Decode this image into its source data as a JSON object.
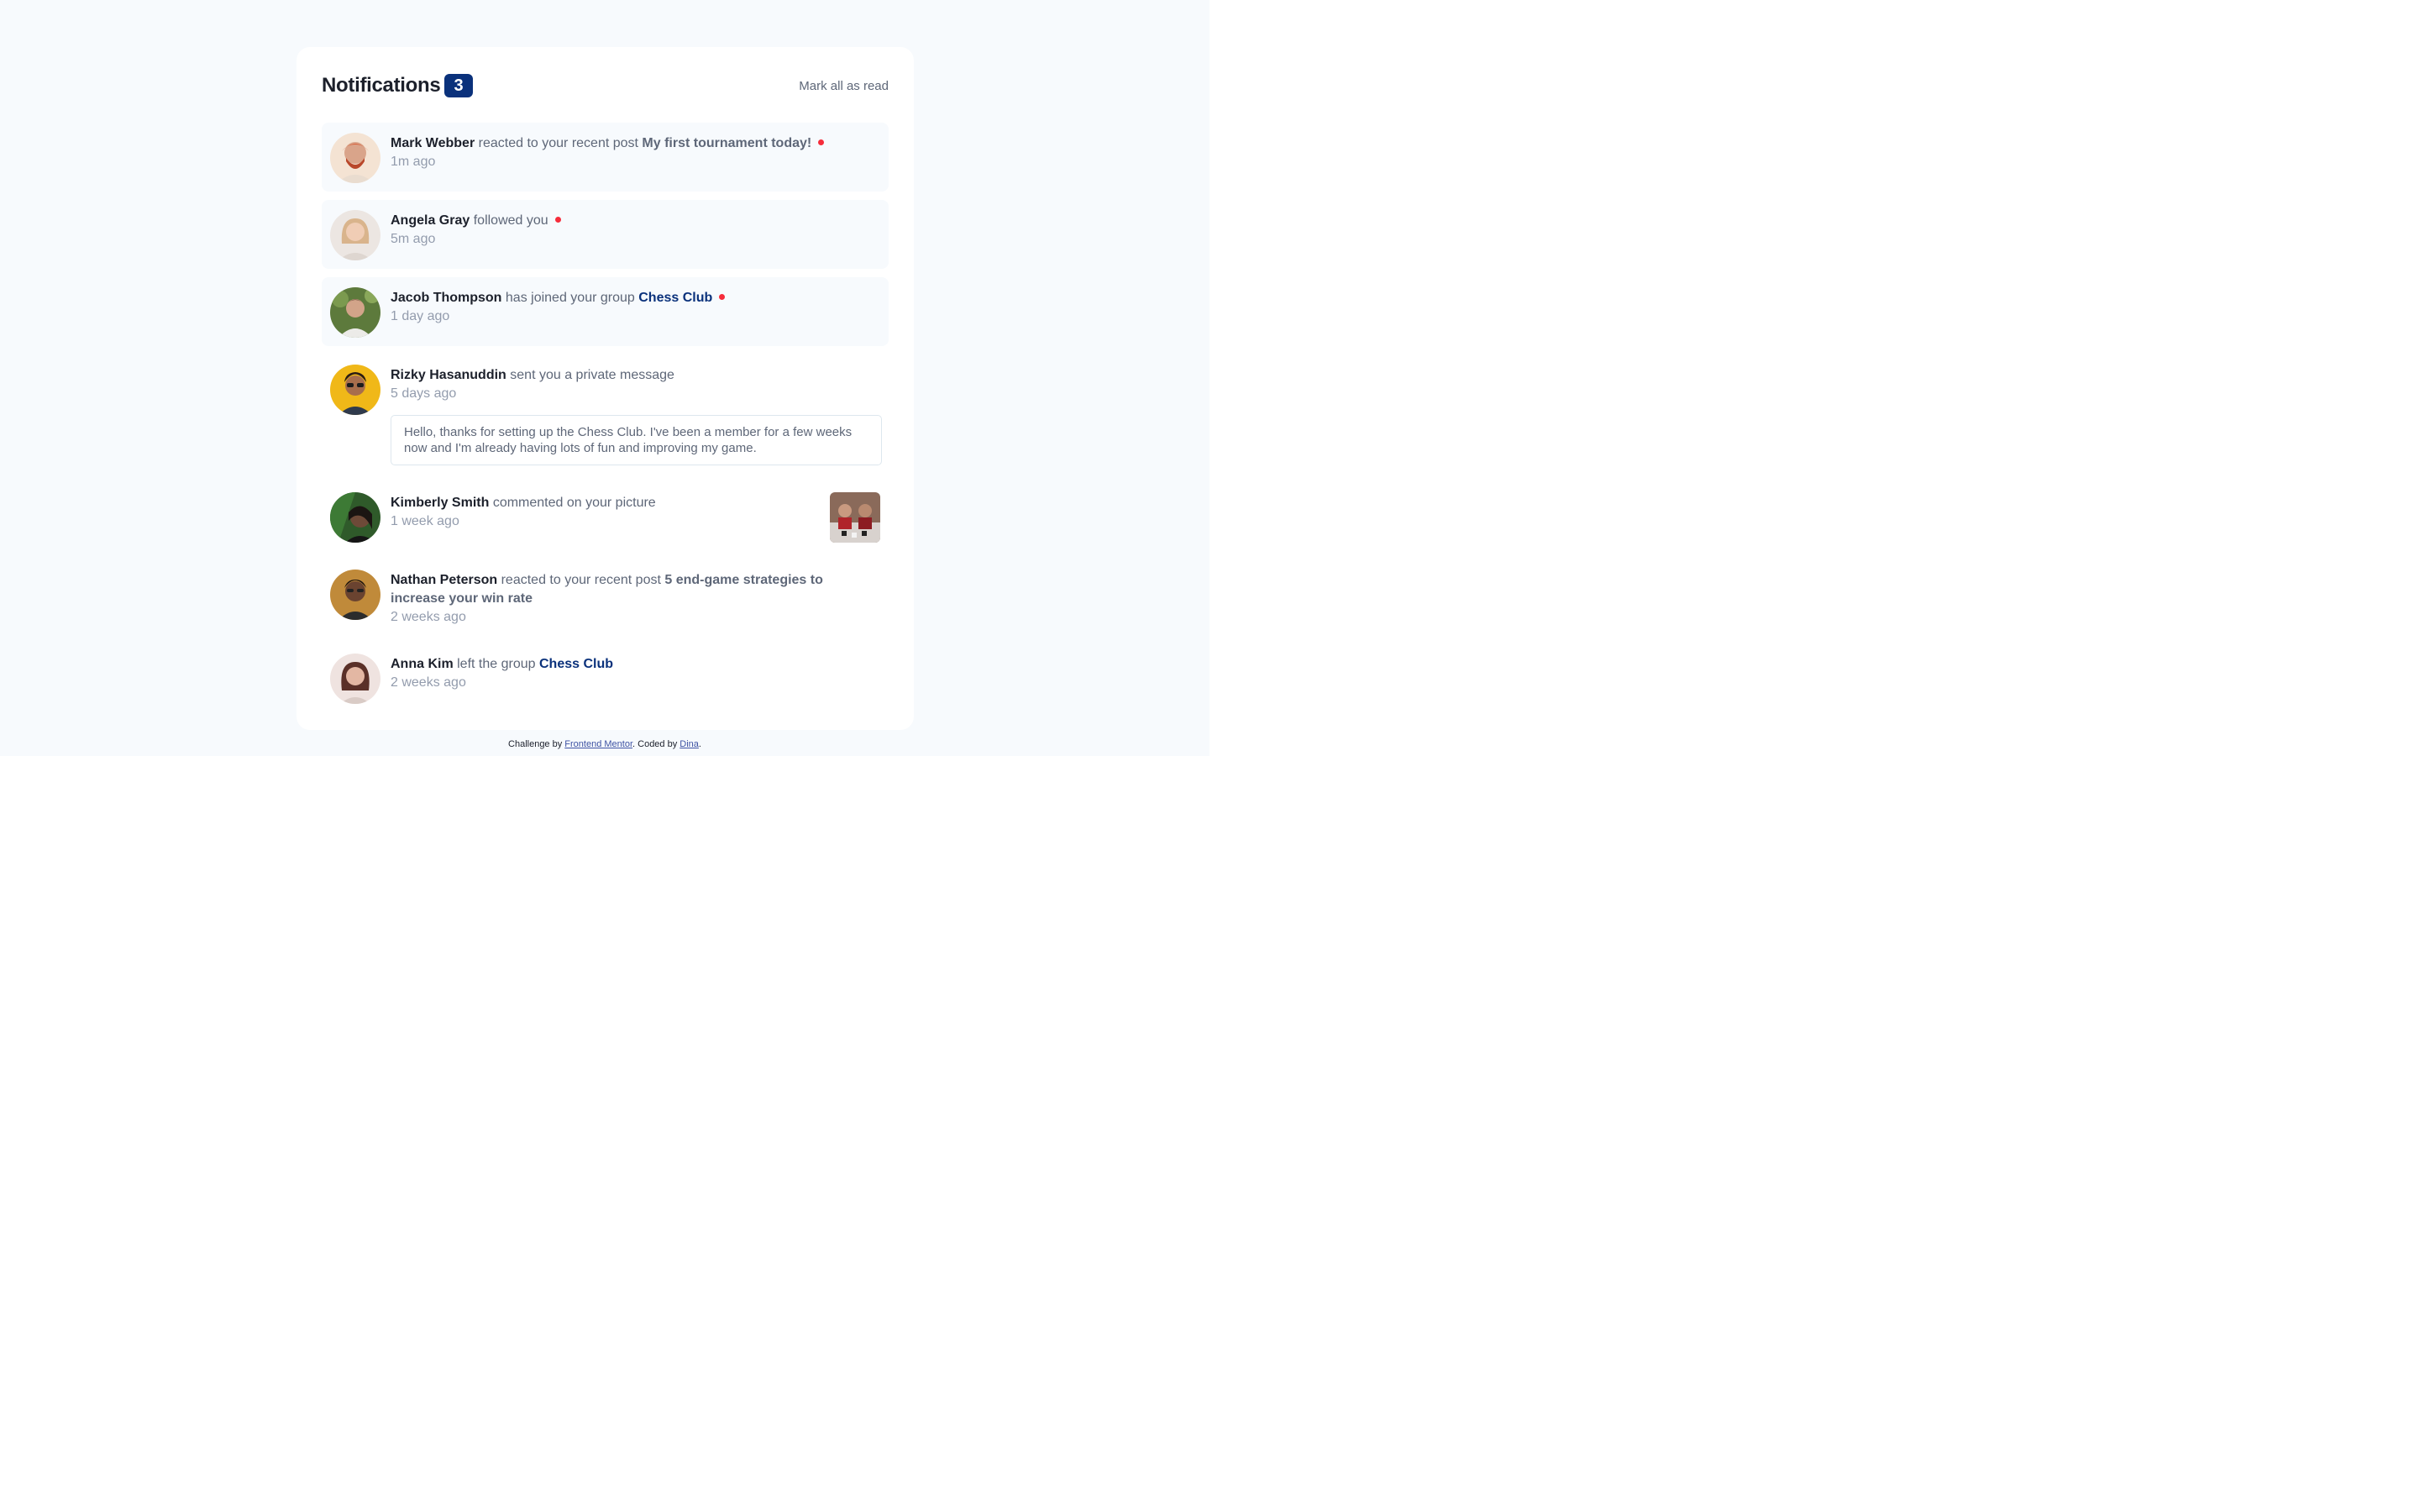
{
  "header": {
    "title": "Notifications",
    "count": "3",
    "mark_all": "Mark all as read"
  },
  "notifications": [
    {
      "name": "Mark Webber",
      "action": "reacted to your recent post",
      "target": "My first tournament today!",
      "time": "1m ago",
      "unread": true
    },
    {
      "name": "Angela Gray",
      "action": "followed you",
      "time": "5m ago",
      "unread": true
    },
    {
      "name": "Jacob Thompson",
      "action": "has joined your group",
      "target": "Chess Club",
      "time": "1 day ago",
      "unread": true
    },
    {
      "name": "Rizky Hasanuddin",
      "action": "sent you a private message",
      "time": "5 days ago",
      "message": "Hello, thanks for setting up the Chess Club. I've been a member for a few weeks now and I'm already having lots of fun and improving my game."
    },
    {
      "name": "Kimberly Smith",
      "action": "commented on your picture",
      "time": "1 week ago"
    },
    {
      "name": "Nathan Peterson",
      "action": "reacted to your recent post",
      "target": "5 end-game strategies to increase your win rate",
      "time": "2 weeks ago"
    },
    {
      "name": "Anna Kim",
      "action": "left the group",
      "target": "Chess Club",
      "time": "2 weeks ago"
    }
  ],
  "footer": {
    "prefix": "Challenge by",
    "link1": "Frontend Mentor",
    "middle": ". Coded by",
    "link2": "Dina",
    "suffix": "."
  },
  "colors": {
    "accent_navy": "#0a317b",
    "unread_dot": "#f62c3b",
    "unread_bg": "#f7fafd"
  }
}
